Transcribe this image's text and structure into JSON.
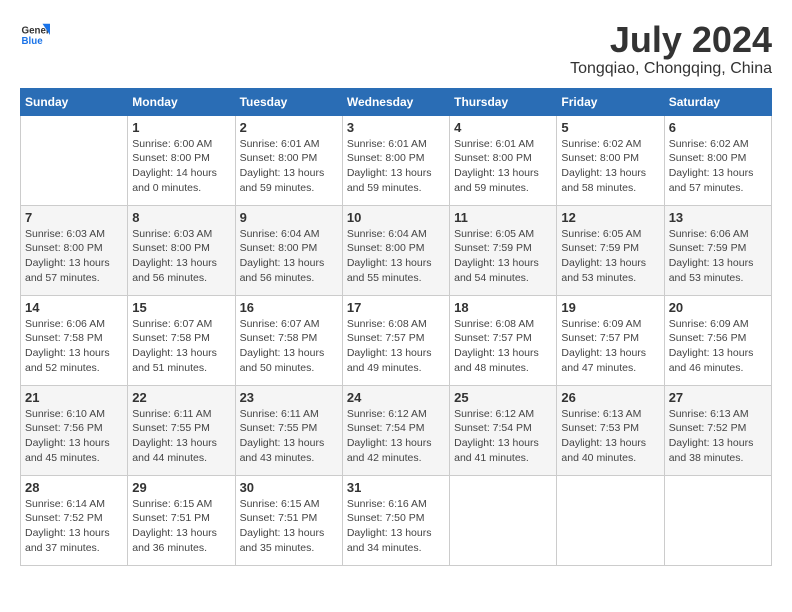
{
  "header": {
    "logo_line1": "General",
    "logo_line2": "Blue",
    "month": "July 2024",
    "location": "Tongqiao, Chongqing, China"
  },
  "weekdays": [
    "Sunday",
    "Monday",
    "Tuesday",
    "Wednesday",
    "Thursday",
    "Friday",
    "Saturday"
  ],
  "weeks": [
    [
      {
        "day": "",
        "sunrise": "",
        "sunset": "",
        "daylight": ""
      },
      {
        "day": "1",
        "sunrise": "Sunrise: 6:00 AM",
        "sunset": "Sunset: 8:00 PM",
        "daylight": "Daylight: 14 hours and 0 minutes."
      },
      {
        "day": "2",
        "sunrise": "Sunrise: 6:01 AM",
        "sunset": "Sunset: 8:00 PM",
        "daylight": "Daylight: 13 hours and 59 minutes."
      },
      {
        "day": "3",
        "sunrise": "Sunrise: 6:01 AM",
        "sunset": "Sunset: 8:00 PM",
        "daylight": "Daylight: 13 hours and 59 minutes."
      },
      {
        "day": "4",
        "sunrise": "Sunrise: 6:01 AM",
        "sunset": "Sunset: 8:00 PM",
        "daylight": "Daylight: 13 hours and 59 minutes."
      },
      {
        "day": "5",
        "sunrise": "Sunrise: 6:02 AM",
        "sunset": "Sunset: 8:00 PM",
        "daylight": "Daylight: 13 hours and 58 minutes."
      },
      {
        "day": "6",
        "sunrise": "Sunrise: 6:02 AM",
        "sunset": "Sunset: 8:00 PM",
        "daylight": "Daylight: 13 hours and 57 minutes."
      }
    ],
    [
      {
        "day": "7",
        "sunrise": "Sunrise: 6:03 AM",
        "sunset": "Sunset: 8:00 PM",
        "daylight": "Daylight: 13 hours and 57 minutes."
      },
      {
        "day": "8",
        "sunrise": "Sunrise: 6:03 AM",
        "sunset": "Sunset: 8:00 PM",
        "daylight": "Daylight: 13 hours and 56 minutes."
      },
      {
        "day": "9",
        "sunrise": "Sunrise: 6:04 AM",
        "sunset": "Sunset: 8:00 PM",
        "daylight": "Daylight: 13 hours and 56 minutes."
      },
      {
        "day": "10",
        "sunrise": "Sunrise: 6:04 AM",
        "sunset": "Sunset: 8:00 PM",
        "daylight": "Daylight: 13 hours and 55 minutes."
      },
      {
        "day": "11",
        "sunrise": "Sunrise: 6:05 AM",
        "sunset": "Sunset: 7:59 PM",
        "daylight": "Daylight: 13 hours and 54 minutes."
      },
      {
        "day": "12",
        "sunrise": "Sunrise: 6:05 AM",
        "sunset": "Sunset: 7:59 PM",
        "daylight": "Daylight: 13 hours and 53 minutes."
      },
      {
        "day": "13",
        "sunrise": "Sunrise: 6:06 AM",
        "sunset": "Sunset: 7:59 PM",
        "daylight": "Daylight: 13 hours and 53 minutes."
      }
    ],
    [
      {
        "day": "14",
        "sunrise": "Sunrise: 6:06 AM",
        "sunset": "Sunset: 7:58 PM",
        "daylight": "Daylight: 13 hours and 52 minutes."
      },
      {
        "day": "15",
        "sunrise": "Sunrise: 6:07 AM",
        "sunset": "Sunset: 7:58 PM",
        "daylight": "Daylight: 13 hours and 51 minutes."
      },
      {
        "day": "16",
        "sunrise": "Sunrise: 6:07 AM",
        "sunset": "Sunset: 7:58 PM",
        "daylight": "Daylight: 13 hours and 50 minutes."
      },
      {
        "day": "17",
        "sunrise": "Sunrise: 6:08 AM",
        "sunset": "Sunset: 7:57 PM",
        "daylight": "Daylight: 13 hours and 49 minutes."
      },
      {
        "day": "18",
        "sunrise": "Sunrise: 6:08 AM",
        "sunset": "Sunset: 7:57 PM",
        "daylight": "Daylight: 13 hours and 48 minutes."
      },
      {
        "day": "19",
        "sunrise": "Sunrise: 6:09 AM",
        "sunset": "Sunset: 7:57 PM",
        "daylight": "Daylight: 13 hours and 47 minutes."
      },
      {
        "day": "20",
        "sunrise": "Sunrise: 6:09 AM",
        "sunset": "Sunset: 7:56 PM",
        "daylight": "Daylight: 13 hours and 46 minutes."
      }
    ],
    [
      {
        "day": "21",
        "sunrise": "Sunrise: 6:10 AM",
        "sunset": "Sunset: 7:56 PM",
        "daylight": "Daylight: 13 hours and 45 minutes."
      },
      {
        "day": "22",
        "sunrise": "Sunrise: 6:11 AM",
        "sunset": "Sunset: 7:55 PM",
        "daylight": "Daylight: 13 hours and 44 minutes."
      },
      {
        "day": "23",
        "sunrise": "Sunrise: 6:11 AM",
        "sunset": "Sunset: 7:55 PM",
        "daylight": "Daylight: 13 hours and 43 minutes."
      },
      {
        "day": "24",
        "sunrise": "Sunrise: 6:12 AM",
        "sunset": "Sunset: 7:54 PM",
        "daylight": "Daylight: 13 hours and 42 minutes."
      },
      {
        "day": "25",
        "sunrise": "Sunrise: 6:12 AM",
        "sunset": "Sunset: 7:54 PM",
        "daylight": "Daylight: 13 hours and 41 minutes."
      },
      {
        "day": "26",
        "sunrise": "Sunrise: 6:13 AM",
        "sunset": "Sunset: 7:53 PM",
        "daylight": "Daylight: 13 hours and 40 minutes."
      },
      {
        "day": "27",
        "sunrise": "Sunrise: 6:13 AM",
        "sunset": "Sunset: 7:52 PM",
        "daylight": "Daylight: 13 hours and 38 minutes."
      }
    ],
    [
      {
        "day": "28",
        "sunrise": "Sunrise: 6:14 AM",
        "sunset": "Sunset: 7:52 PM",
        "daylight": "Daylight: 13 hours and 37 minutes."
      },
      {
        "day": "29",
        "sunrise": "Sunrise: 6:15 AM",
        "sunset": "Sunset: 7:51 PM",
        "daylight": "Daylight: 13 hours and 36 minutes."
      },
      {
        "day": "30",
        "sunrise": "Sunrise: 6:15 AM",
        "sunset": "Sunset: 7:51 PM",
        "daylight": "Daylight: 13 hours and 35 minutes."
      },
      {
        "day": "31",
        "sunrise": "Sunrise: 6:16 AM",
        "sunset": "Sunset: 7:50 PM",
        "daylight": "Daylight: 13 hours and 34 minutes."
      },
      {
        "day": "",
        "sunrise": "",
        "sunset": "",
        "daylight": ""
      },
      {
        "day": "",
        "sunrise": "",
        "sunset": "",
        "daylight": ""
      },
      {
        "day": "",
        "sunrise": "",
        "sunset": "",
        "daylight": ""
      }
    ]
  ]
}
